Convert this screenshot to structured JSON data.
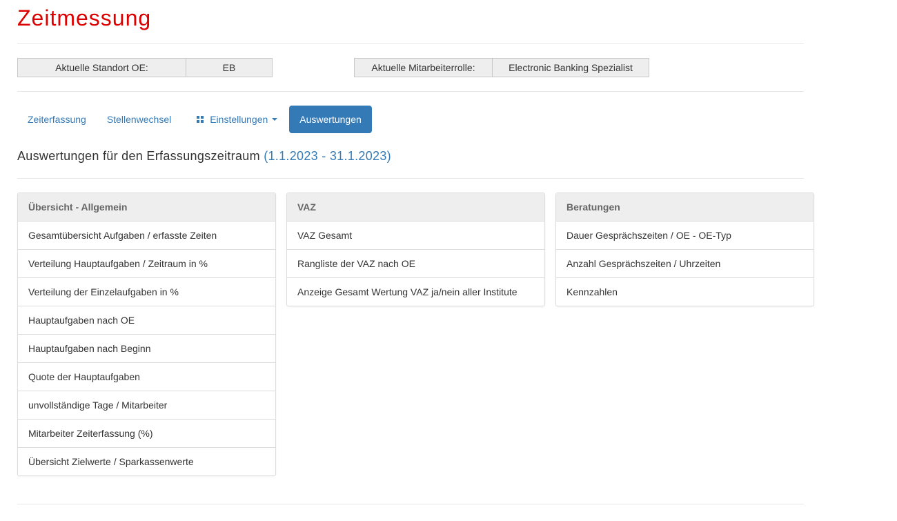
{
  "page": {
    "title": "Zeitmessung"
  },
  "info": {
    "standort_label": "Aktuelle Standort OE:",
    "standort_value": "EB",
    "rolle_label": "Aktuelle Mitarbeiterrolle:",
    "rolle_value": "Electronic Banking Spezialist"
  },
  "nav": {
    "zeiterfassung": "Zeiterfassung",
    "stellenwechsel": "Stellenwechsel",
    "einstellungen": "Einstellungen",
    "auswertungen": "Auswertungen"
  },
  "heading": {
    "text": "Auswertungen für den Erfassungszeitraum",
    "period": "(1.1.2023 - 31.1.2023)"
  },
  "panels": [
    {
      "title": "Übersicht - Allgemein",
      "items": [
        "Gesamtübersicht Aufgaben / erfasste Zeiten",
        "Verteilung Hauptaufgaben / Zeitraum in %",
        "Verteilung der Einzelaufgaben in %",
        "Hauptaufgaben nach OE",
        "Hauptaufgaben nach Beginn",
        "Quote der Hauptaufgaben",
        "unvollständige Tage / Mitarbeiter",
        "Mitarbeiter Zeiterfassung (%)",
        "Übersicht Zielwerte / Sparkassenwerte"
      ]
    },
    {
      "title": "VAZ",
      "items": [
        "VAZ Gesamt",
        "Rangliste der VAZ nach OE",
        "Anzeige Gesamt Wertung VAZ ja/nein aller Institute"
      ]
    },
    {
      "title": "Beratungen",
      "items": [
        "Dauer Gesprächszeiten / OE - OE-Typ",
        "Anzahl Gesprächszeiten / Uhrzeiten",
        "Kennzahlen"
      ]
    }
  ],
  "colors": {
    "title": "#dd0000",
    "link": "#337ab7",
    "active_bg": "#337ab7"
  },
  "icons": {
    "einstellungen": "grid-icon",
    "dropdown": "caret-down-icon"
  }
}
